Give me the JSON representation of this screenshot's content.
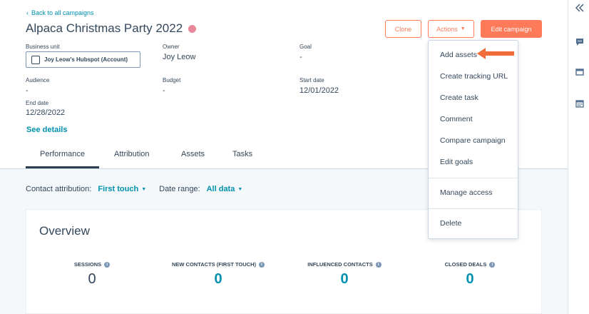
{
  "header": {
    "back_link": "Back to all campaigns",
    "title": "Alpaca Christmas Party 2022",
    "status_color": "#e8889b",
    "buttons": {
      "clone": "Clone",
      "actions": "Actions",
      "edit": "Edit campaign"
    }
  },
  "fields": {
    "business_unit": {
      "label": "Business unit",
      "value": "Joy Leow's Hubspot (Account)"
    },
    "owner": {
      "label": "Owner",
      "value": "Joy Leow"
    },
    "goal": {
      "label": "Goal",
      "value": "-"
    },
    "audience": {
      "label": "Audience",
      "value": "-"
    },
    "budget": {
      "label": "Budget",
      "value": "-"
    },
    "start_date": {
      "label": "Start date",
      "value": "12/01/2022"
    },
    "end_date": {
      "label": "End date",
      "value": "12/28/2022"
    }
  },
  "see_details": "See details",
  "tabs": [
    "Performance",
    "Attribution",
    "Assets",
    "Tasks"
  ],
  "filters": {
    "attribution_label": "Contact attribution:",
    "attribution_value": "First touch",
    "range_label": "Date range:",
    "range_value": "All data"
  },
  "overview": {
    "title": "Overview",
    "stats": [
      {
        "label": "SESSIONS",
        "value": "0"
      },
      {
        "label": "NEW CONTACTS (FIRST TOUCH)",
        "value": "0"
      },
      {
        "label": "INFLUENCED CONTACTS",
        "value": "0"
      },
      {
        "label": "CLOSED DEALS",
        "value": "0"
      }
    ]
  },
  "actions_menu": {
    "items": [
      "Add assets",
      "Create tracking URL",
      "Create task",
      "Comment",
      "Compare campaign",
      "Edit goals"
    ],
    "manage_access": "Manage access",
    "delete": "Delete"
  },
  "colors": {
    "accent": "#ff7a59",
    "link": "#0091ae",
    "text": "#33475b"
  }
}
